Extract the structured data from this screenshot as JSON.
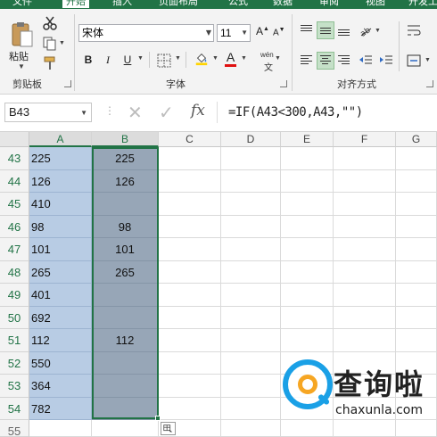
{
  "ribbon_tabs": [
    "文件",
    "开始",
    "插入",
    "页面布局",
    "公式",
    "数据",
    "审阅",
    "视图",
    "开发工"
  ],
  "active_tab": "开始",
  "clipboard": {
    "paste_label": "粘贴",
    "group_label": "剪贴板"
  },
  "font": {
    "name": "宋体",
    "size": "11",
    "group_label": "字体",
    "bold": "B",
    "italic": "I",
    "underline": "U",
    "grow": "A",
    "shrink": "A",
    "font_color_glyph": "A",
    "wen_glyph": "wén"
  },
  "alignment": {
    "group_label": "对齐方式"
  },
  "formula_bar": {
    "name_box": "B43",
    "fx": "fx",
    "formula": "=IF(A43<300,A43,\"\")"
  },
  "columns": [
    "A",
    "B",
    "C",
    "D",
    "E",
    "F",
    "G"
  ],
  "rows": [
    {
      "num": "43",
      "a": "225",
      "b": "225"
    },
    {
      "num": "44",
      "a": "126",
      "b": "126"
    },
    {
      "num": "45",
      "a": "410",
      "b": ""
    },
    {
      "num": "46",
      "a": "98",
      "b": "98"
    },
    {
      "num": "47",
      "a": "101",
      "b": "101"
    },
    {
      "num": "48",
      "a": "265",
      "b": "265"
    },
    {
      "num": "49",
      "a": "401",
      "b": ""
    },
    {
      "num": "50",
      "a": "692",
      "b": ""
    },
    {
      "num": "51",
      "a": "112",
      "b": "112"
    },
    {
      "num": "52",
      "a": "550",
      "b": ""
    },
    {
      "num": "53",
      "a": "364",
      "b": ""
    },
    {
      "num": "54",
      "a": "782",
      "b": ""
    }
  ],
  "extra_row": "55",
  "watermark": {
    "brand": "查询啦",
    "url": "chaxunla.com"
  },
  "colors": {
    "excel_green": "#217346",
    "sel_a": "#b8cce4",
    "sel_b": "#97a6b7"
  }
}
